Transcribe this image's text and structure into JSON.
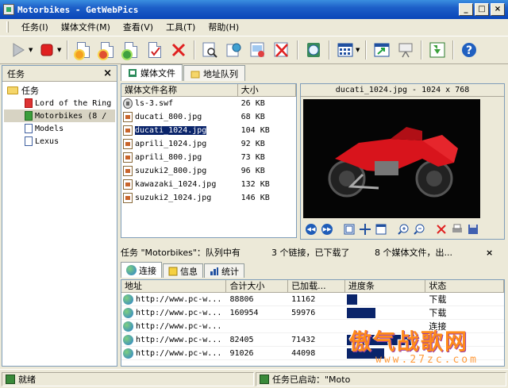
{
  "window": {
    "title": "Motorbikes - GetWebPics"
  },
  "menu": [
    "任务(I)",
    "媒体文件(M)",
    "查看(V)",
    "工具(T)",
    "帮助(H)"
  ],
  "left_pane": {
    "title": "任务",
    "close_label": "×",
    "root": "任务",
    "items": [
      {
        "label": "Lord of the Ring",
        "state": "stopped"
      },
      {
        "label": "Motorbikes (8 /",
        "state": "running"
      },
      {
        "label": "Models",
        "state": "idle"
      },
      {
        "label": "Lexus",
        "state": "idle"
      }
    ]
  },
  "tabs": [
    "媒体文件",
    "地址队列"
  ],
  "file_list": {
    "headers": [
      "媒体文件名称",
      "大小"
    ],
    "rows": [
      {
        "name": "ls-3.swf",
        "size": "26 KB",
        "type": "swf"
      },
      {
        "name": "ducati_800.jpg",
        "size": "68 KB",
        "type": "jpg"
      },
      {
        "name": "ducati_1024.jpg",
        "size": "104 KB",
        "type": "jpg",
        "selected": true
      },
      {
        "name": "aprili_1024.jpg",
        "size": "92 KB",
        "type": "jpg"
      },
      {
        "name": "aprili_800.jpg",
        "size": "73 KB",
        "type": "jpg"
      },
      {
        "name": "suzuki2_800.jpg",
        "size": "96 KB",
        "type": "jpg"
      },
      {
        "name": "kawazaki_1024.jpg",
        "size": "132 KB",
        "type": "jpg"
      },
      {
        "name": "suzuki2_1024.jpg",
        "size": "146 KB",
        "type": "jpg"
      }
    ]
  },
  "preview": {
    "title": "ducati_1024.jpg - 1024 x 768"
  },
  "task_status": {
    "name": "任务 \"Motorbikes\"：队列中有",
    "links": "3 个链接，已下载了",
    "media": "8 个媒体文件，出..."
  },
  "sub_tabs": [
    "连接",
    "信息",
    "统计"
  ],
  "connections": {
    "headers": [
      "地址",
      "合计大小",
      "已加载...",
      "进度条",
      "状态"
    ],
    "rows": [
      {
        "url": "http://www.pc-w...",
        "total": "88806",
        "loaded": "11162",
        "progress": 0.13,
        "status": "下载"
      },
      {
        "url": "http://www.pc-w...",
        "total": "160954",
        "loaded": "59976",
        "progress": 0.37,
        "status": "下载"
      },
      {
        "url": "http://www.pc-w...",
        "total": "",
        "loaded": "",
        "progress": 0,
        "status": "连接"
      },
      {
        "url": "http://www.pc-w...",
        "total": "82405",
        "loaded": "71432",
        "progress": 0.87,
        "status": ""
      },
      {
        "url": "http://www.pc-w...",
        "total": "91026",
        "loaded": "44098",
        "progress": 0.48,
        "status": ""
      }
    ]
  },
  "watermark": {
    "text": "傲气战歌网",
    "url": "www.27zc.com"
  },
  "statusbar": {
    "state": "就绪",
    "message": "任务已启动：\"Moto"
  }
}
